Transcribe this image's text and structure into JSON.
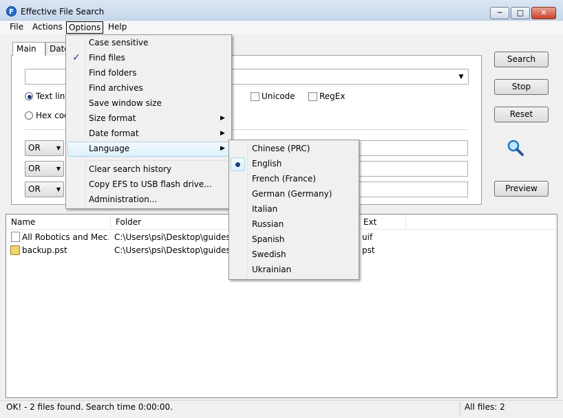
{
  "window": {
    "title": "Effective File Search",
    "app_icon_letter": "F"
  },
  "menubar": [
    "File",
    "Actions",
    "Options",
    "Help"
  ],
  "tabs": [
    "Main",
    "Date"
  ],
  "search": {
    "radios": [
      "Text line",
      "Hex code"
    ],
    "checkboxes": [
      "Unicode",
      "RegEx"
    ],
    "logic": [
      "OR",
      "OR",
      "OR"
    ]
  },
  "buttons": {
    "search": "Search",
    "stop": "Stop",
    "reset": "Reset",
    "preview": "Preview"
  },
  "results": {
    "columns": [
      "Name",
      "Folder",
      "Ext"
    ],
    "rows": [
      {
        "name": "All Robotics and Mec...",
        "folder": "C:\\Users\\psi\\Desktop\\guides ...",
        "ext": "uif",
        "icon": "document-icon"
      },
      {
        "name": "backup.pst",
        "folder": "C:\\Users\\psi\\Desktop\\guides ...",
        "ext": "pst",
        "icon": "pst-file-icon"
      }
    ]
  },
  "status": {
    "text": "OK! - 2 files found. Search time 0:00:00.",
    "files": "All files: 2"
  },
  "options_menu": {
    "items": [
      "Case sensitive",
      "Find files",
      "Find folders",
      "Find archives",
      "Save window size",
      "Size format",
      "Date format",
      "Language",
      "Clear search history",
      "Copy EFS to USB flash drive...",
      "Administration..."
    ],
    "checked": "Find files",
    "highlighted": "Language"
  },
  "language_menu": {
    "items": [
      "Chinese (PRC)",
      "English",
      "French (France)",
      "German (Germany)",
      "Italian",
      "Russian",
      "Spanish",
      "Swedish",
      "Ukrainian"
    ],
    "selected": "English"
  }
}
